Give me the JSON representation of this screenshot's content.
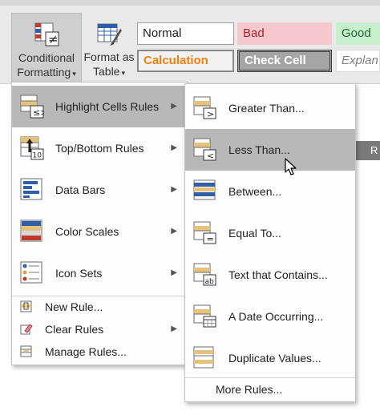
{
  "ribbon": {
    "conditional_formatting": {
      "line1": "Conditional",
      "line2": "Formatting"
    },
    "format_as_table": {
      "line1": "Format as",
      "line2": "Table"
    },
    "styles": {
      "normal": "Normal",
      "bad": "Bad",
      "good": "Good",
      "calculation": "Calculation",
      "check_cell": "Check Cell",
      "explanatory": "Explan"
    },
    "sheet_strip": "R"
  },
  "main_menu": {
    "items": [
      {
        "label": "Highlight Cells Rules",
        "icon": "highlight-cells-icon"
      },
      {
        "label": "Top/Bottom Rules",
        "icon": "top-bottom-icon"
      },
      {
        "label": "Data Bars",
        "icon": "data-bars-icon"
      },
      {
        "label": "Color Scales",
        "icon": "color-scales-icon"
      },
      {
        "label": "Icon Sets",
        "icon": "icon-sets-icon"
      }
    ],
    "small_items": [
      {
        "label": "New Rule...",
        "icon": "new-rule-icon"
      },
      {
        "label": "Clear Rules",
        "icon": "clear-rules-icon"
      },
      {
        "label": "Manage Rules...",
        "icon": "manage-rules-icon"
      }
    ]
  },
  "sub_menu": {
    "items": [
      {
        "label": "Greater Than...",
        "icon": "greater-than-icon"
      },
      {
        "label": "Less Than...",
        "icon": "less-than-icon"
      },
      {
        "label": "Between...",
        "icon": "between-icon"
      },
      {
        "label": "Equal To...",
        "icon": "equal-to-icon"
      },
      {
        "label": "Text that Contains...",
        "icon": "text-contains-icon"
      },
      {
        "label": "A Date Occurring...",
        "icon": "date-occurring-icon"
      },
      {
        "label": "Duplicate Values...",
        "icon": "duplicate-values-icon"
      }
    ],
    "more_rules": "More Rules..."
  },
  "colors": {
    "highlight": "#b8b8b8",
    "bad_fill": "#f7c7ce",
    "good_fill": "#c6efce",
    "calculation_text": "#f07f0d"
  }
}
